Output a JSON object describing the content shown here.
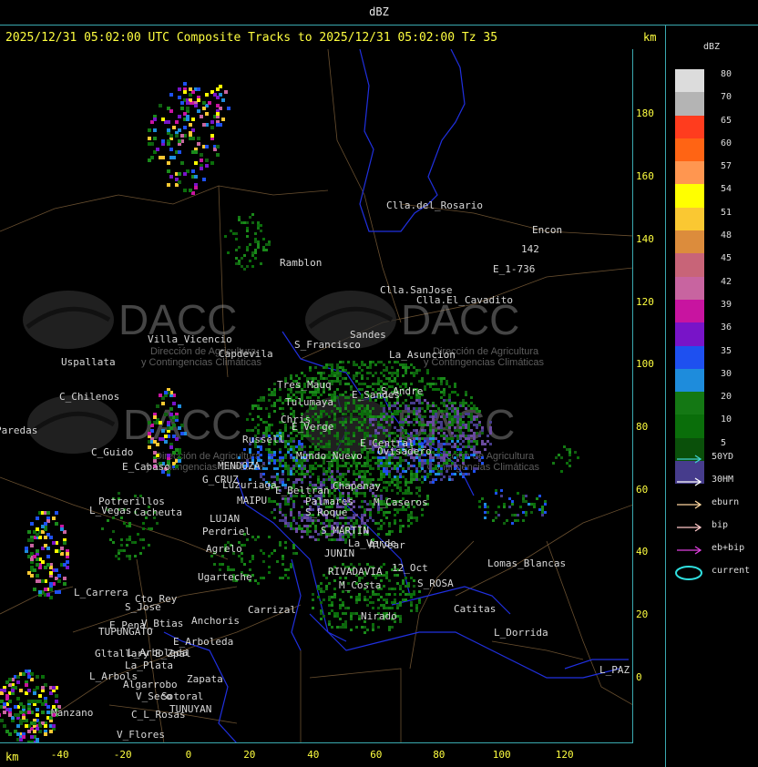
{
  "window_title": "dBZ",
  "header": {
    "title": "2025/12/31 05:02:00 UTC Composite Tracks to 2025/12/31 05:02:00 Tz 35",
    "km_label": "km"
  },
  "axes": {
    "x_unit": "km",
    "x_ticks": [
      "-40",
      "-20",
      "0",
      "20",
      "40",
      "60",
      "80",
      "100",
      "120"
    ],
    "y_ticks": [
      "180",
      "160",
      "140",
      "120",
      "100",
      "80",
      "60",
      "40",
      "20",
      "0"
    ]
  },
  "legend": {
    "title": "dBZ",
    "levels": [
      {
        "value": "80",
        "color": "#dcdcdc"
      },
      {
        "value": "70",
        "color": "#b4b4b4"
      },
      {
        "value": "65",
        "color": "#ff3c1e"
      },
      {
        "value": "60",
        "color": "#ff6414"
      },
      {
        "value": "57",
        "color": "#ff9650"
      },
      {
        "value": "54",
        "color": "#ffff00"
      },
      {
        "value": "51",
        "color": "#fac832"
      },
      {
        "value": "48",
        "color": "#dc8c3c"
      },
      {
        "value": "45",
        "color": "#c86478"
      },
      {
        "value": "42",
        "color": "#c864a0"
      },
      {
        "value": "39",
        "color": "#c814a0"
      },
      {
        "value": "36",
        "color": "#7814c8"
      },
      {
        "value": "35",
        "color": "#1e50f0"
      },
      {
        "value": "30",
        "color": "#1e8cdc"
      },
      {
        "value": "20",
        "color": "#147814"
      },
      {
        "value": "10",
        "color": "#0a6e0a"
      },
      {
        "value": "5",
        "color": "#0a500a"
      },
      {
        "value": "",
        "color": "#463c8c"
      }
    ]
  },
  "track_legend": [
    {
      "label": "50YD",
      "color": "#40d0d0"
    },
    {
      "label": "30HM",
      "color": "#ffffff"
    },
    {
      "label": "eburn",
      "color": "#ffd7a0"
    },
    {
      "label": "bip",
      "color": "#ffc8c8"
    },
    {
      "label": "eb+bip",
      "color": "#e040e0"
    },
    {
      "label": "current",
      "color": "#30e0e0"
    }
  ],
  "watermark": {
    "brand": "DACC",
    "line1": "Dirección de Agricultura",
    "line2": "y Contingencias Climáticas"
  },
  "places": [
    {
      "name": "Clla.del_Rosario"
    },
    {
      "name": "Encon"
    },
    {
      "name": "Ramblon"
    },
    {
      "name": "E_1-736"
    },
    {
      "name": "142"
    },
    {
      "name": "Clla.SanJose"
    },
    {
      "name": "Clla.El_Cavadito"
    },
    {
      "name": "Villa_Vicencio"
    },
    {
      "name": "Uspallata"
    },
    {
      "name": "Capdevila"
    },
    {
      "name": "S_Francisco"
    },
    {
      "name": "Sandes"
    },
    {
      "name": "La_Asuncion"
    },
    {
      "name": "C_Chilenos"
    },
    {
      "name": "Tres_Mauq"
    },
    {
      "name": "Tulumaya"
    },
    {
      "name": "E_Sandes"
    },
    {
      "name": "S_Andre"
    },
    {
      "name": "Paredas"
    },
    {
      "name": "Chris"
    },
    {
      "name": "E_Verge"
    },
    {
      "name": "C_Guido"
    },
    {
      "name": "Russell"
    },
    {
      "name": "E_Central"
    },
    {
      "name": "Mundo_Nuevo"
    },
    {
      "name": "Ovisadero"
    },
    {
      "name": "E_Cabaso"
    },
    {
      "name": "MENDOZA"
    },
    {
      "name": "G_CRUZ"
    },
    {
      "name": "Luzuriaga"
    },
    {
      "name": "Chapenay"
    },
    {
      "name": "Potrerillos"
    },
    {
      "name": "E_Beltran"
    },
    {
      "name": "Cacheuta"
    },
    {
      "name": "MAIPU"
    },
    {
      "name": "Palmares"
    },
    {
      "name": "M_Caseros"
    },
    {
      "name": "L_Vegas"
    },
    {
      "name": "LUJAN"
    },
    {
      "name": "S_Roque"
    },
    {
      "name": "Perdriel"
    },
    {
      "name": "Agrelo"
    },
    {
      "name": "S_MARTIN"
    },
    {
      "name": "La_Verde"
    },
    {
      "name": "Alvear"
    },
    {
      "name": "JUNIN"
    },
    {
      "name": "Ugarteche"
    },
    {
      "name": "RIVADAVIA"
    },
    {
      "name": "12_Oct"
    },
    {
      "name": "L_Carrera"
    },
    {
      "name": "Cto_Rey"
    },
    {
      "name": "S_Jose"
    },
    {
      "name": "Carrizal"
    },
    {
      "name": "S_ROSA"
    },
    {
      "name": "Lomas_Blancas"
    },
    {
      "name": "E_Pena"
    },
    {
      "name": "V_Btias"
    },
    {
      "name": "Anchoris"
    },
    {
      "name": "TUPUNGATO"
    },
    {
      "name": "Catitas"
    },
    {
      "name": "Nirado"
    },
    {
      "name": "E_Arboleda"
    },
    {
      "name": "L_Dorrida"
    },
    {
      "name": "Gltallary"
    },
    {
      "name": "E_Zpal"
    },
    {
      "name": "L_Arboleda"
    },
    {
      "name": "La_Plata"
    },
    {
      "name": "L_Arbols"
    },
    {
      "name": "Zapata"
    },
    {
      "name": "Algarrobo"
    },
    {
      "name": "V_Seco"
    },
    {
      "name": "Sotoral"
    },
    {
      "name": "TUNUYAN"
    },
    {
      "name": "Manzano"
    },
    {
      "name": "C_L_Rosas"
    },
    {
      "name": "V_Flores"
    },
    {
      "name": "L_PAZ"
    },
    {
      "name": "M_Costa"
    }
  ]
}
